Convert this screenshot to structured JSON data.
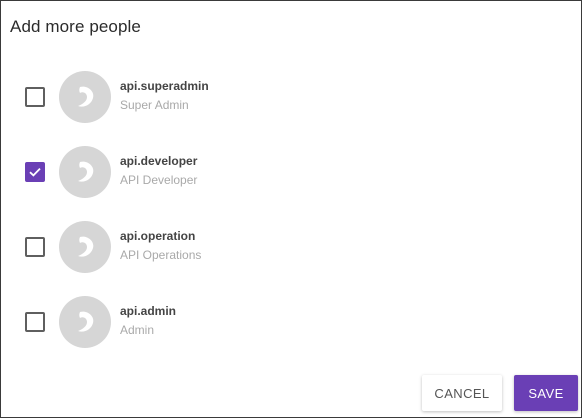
{
  "dialog": {
    "title": "Add more people",
    "cancel_label": "CANCEL",
    "save_label": "SAVE"
  },
  "colors": {
    "accent": "#6a3fb5",
    "avatar_bg": "#d6d6d6",
    "secondary_text": "#a9a9a9"
  },
  "people": [
    {
      "username": "api.superadmin",
      "role": "Super Admin",
      "checked": false,
      "avatar_icon": "user-avatar-icon"
    },
    {
      "username": "api.developer",
      "role": "API Developer",
      "checked": true,
      "avatar_icon": "user-avatar-icon"
    },
    {
      "username": "api.operation",
      "role": "API Operations",
      "checked": false,
      "avatar_icon": "user-avatar-icon"
    },
    {
      "username": "api.admin",
      "role": "Admin",
      "checked": false,
      "avatar_icon": "user-avatar-icon"
    }
  ]
}
